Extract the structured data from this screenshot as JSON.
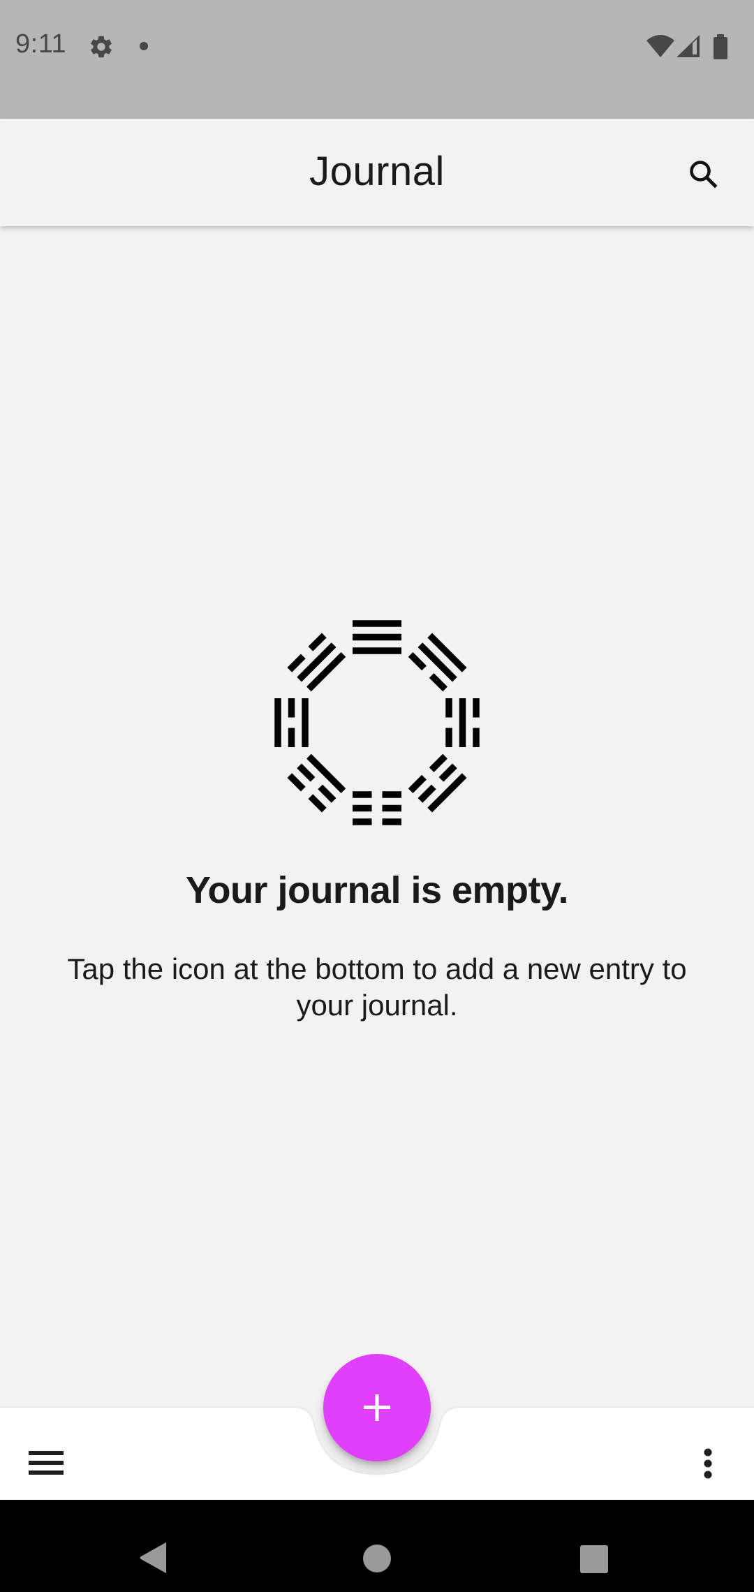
{
  "status_bar": {
    "time": "9:11",
    "icons": [
      "gear-icon",
      "notification-dot",
      "wifi-icon",
      "cell-signal-icon",
      "battery-icon"
    ]
  },
  "app_bar": {
    "title": "Journal",
    "actions": [
      {
        "icon": "search-icon",
        "label": "Search"
      }
    ]
  },
  "empty_state": {
    "illustration": "bagua-icon",
    "trigrams": [
      {
        "position": "top",
        "lines": [
          1,
          1,
          1
        ]
      },
      {
        "position": "top-right",
        "lines": [
          1,
          1,
          0
        ]
      },
      {
        "position": "right",
        "lines": [
          0,
          1,
          0
        ]
      },
      {
        "position": "bottom-right",
        "lines": [
          1,
          0,
          0
        ]
      },
      {
        "position": "bottom",
        "lines": [
          0,
          0,
          0
        ]
      },
      {
        "position": "bottom-left",
        "lines": [
          0,
          0,
          1
        ]
      },
      {
        "position": "left",
        "lines": [
          1,
          0,
          1
        ]
      },
      {
        "position": "top-left",
        "lines": [
          0,
          1,
          1
        ]
      }
    ],
    "title": "Your journal is empty.",
    "description": "Tap the icon at the bottom to add a new entry to your journal."
  },
  "bottom_app_bar": {
    "left_icon": "menu-icon",
    "right_icon": "more-vert-icon",
    "fab": {
      "icon": "plus-icon",
      "label": "Add entry",
      "color": "#e040fb"
    }
  },
  "nav_bar": {
    "buttons": [
      "back",
      "home",
      "recents"
    ]
  },
  "colors": {
    "status_bar_bg": "#b6b6b6",
    "background": "#f2f2f2",
    "accent": "#e040fb",
    "text": "#1a1a1a"
  }
}
